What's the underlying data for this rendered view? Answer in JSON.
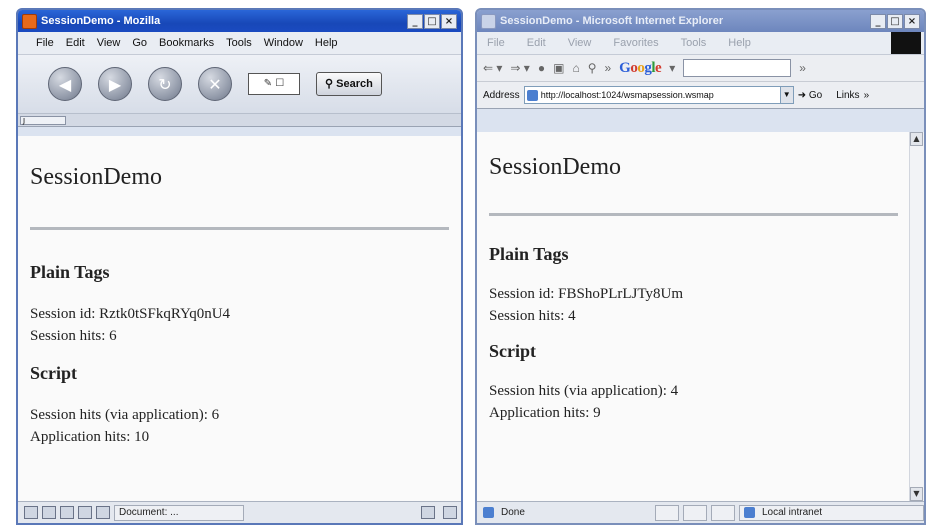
{
  "mozilla": {
    "title": "SessionDemo - Mozilla",
    "menu": [
      "File",
      "Edit",
      "View",
      "Go",
      "Bookmarks",
      "Tools",
      "Window",
      "Help"
    ],
    "search_label": "Search",
    "status_text": "Document: ...",
    "page": {
      "heading": "SessionDemo",
      "plain_tags_heading": "Plain Tags",
      "session_id": "Session id: Rztk0tSFkqRYq0nU4",
      "session_hits": "Session hits: 6",
      "script_heading": "Script",
      "session_hits_app": "Session hits (via application): 6",
      "application_hits": "Application hits: 10"
    }
  },
  "ie": {
    "title": "SessionDemo - Microsoft Internet Explorer",
    "menu": [
      "File",
      "Edit",
      "View",
      "Favorites",
      "Tools",
      "Help"
    ],
    "address_label": "Address",
    "url": "http://localhost:1024/wsmapsession.wsmap",
    "go_label": "Go",
    "links_label": "Links",
    "status_text": "Done",
    "zone_text": "Local intranet",
    "page": {
      "heading": "SessionDemo",
      "plain_tags_heading": "Plain Tags",
      "session_id": "Session id: FBShoPLrLJTy8Um",
      "session_hits": "Session hits: 4",
      "script_heading": "Script",
      "session_hits_app": "Session hits (via application): 4",
      "application_hits": "Application hits: 9"
    }
  }
}
